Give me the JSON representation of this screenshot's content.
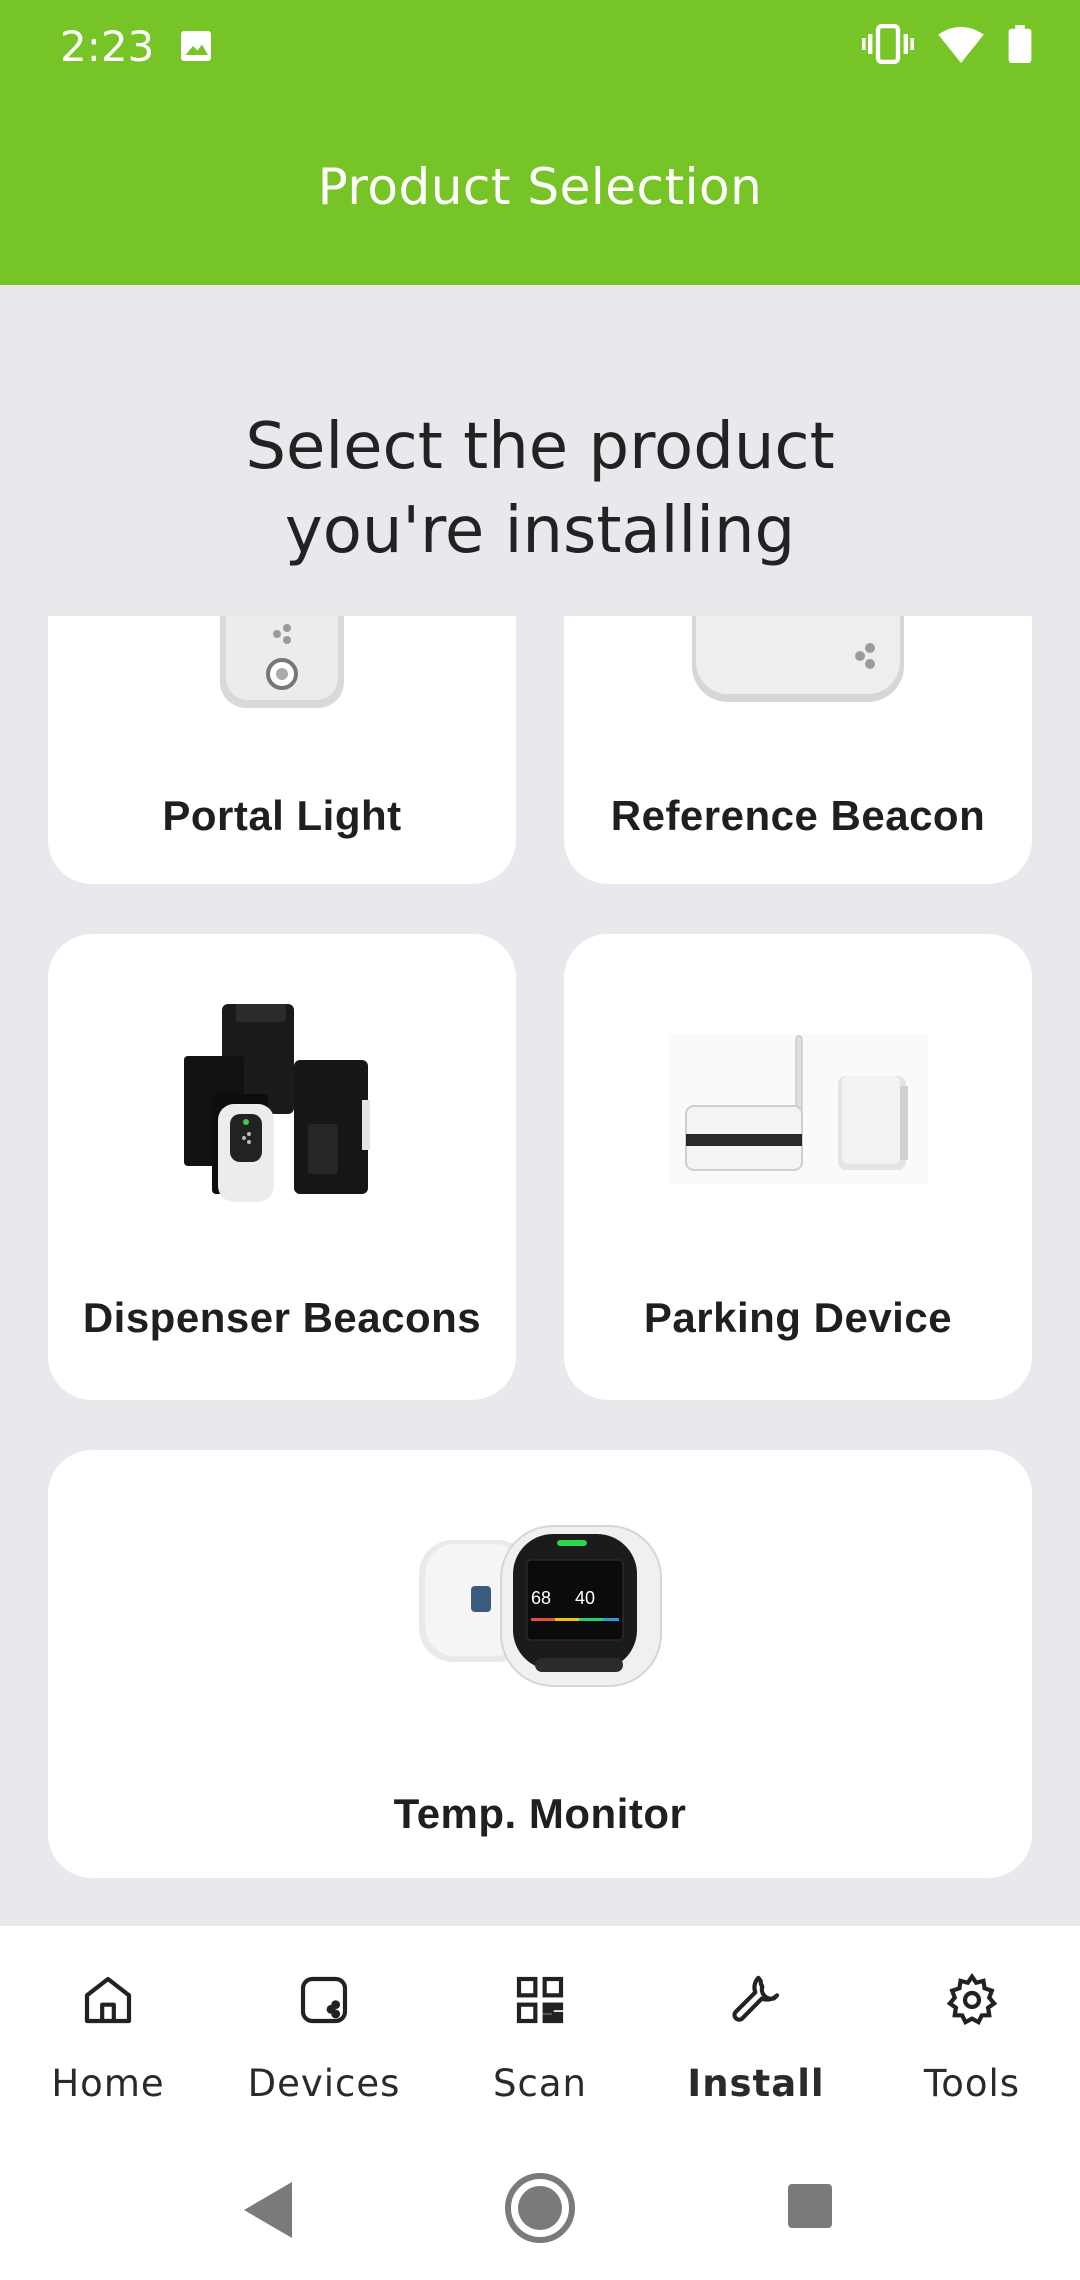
{
  "status_bar": {
    "time": "2:23"
  },
  "header": {
    "title": "Product Selection"
  },
  "heading": {
    "line1": "Select the product",
    "line2": "you're installing"
  },
  "products": [
    {
      "label": "Portal Light"
    },
    {
      "label": "Reference Beacon"
    },
    {
      "label": "Dispenser Beacons"
    },
    {
      "label": "Parking Device"
    },
    {
      "label": "Temp. Monitor"
    }
  ],
  "thumbnail_text": {
    "reading1": "68",
    "reading2": "40"
  },
  "bottom_nav": {
    "items": [
      {
        "label": "Home",
        "icon": "home-icon"
      },
      {
        "label": "Devices",
        "icon": "device-icon"
      },
      {
        "label": "Scan",
        "icon": "qr-code-icon"
      },
      {
        "label": "Install",
        "icon": "wrench-icon",
        "active": true
      },
      {
        "label": "Tools",
        "icon": "gear-icon"
      }
    ]
  },
  "colors": {
    "accent": "#76C426",
    "background": "#E8E8ED",
    "card": "#FFFFFF"
  }
}
